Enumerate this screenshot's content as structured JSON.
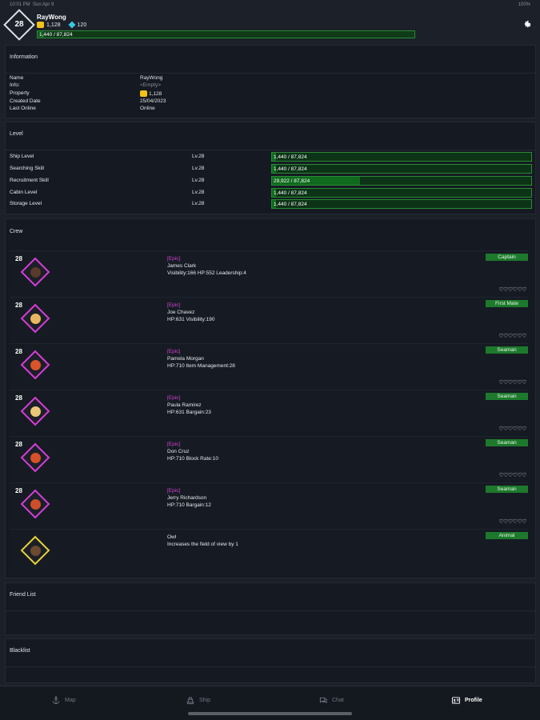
{
  "statusbar": {
    "time": "10:01 PM",
    "date": "Sun Apr 9",
    "battery": "100%"
  },
  "header": {
    "level": "28",
    "username": "RayWong",
    "coins": "1,128",
    "gems": "120",
    "xp_text": "1,440 / 87,824",
    "xp_fraction": 0.016
  },
  "information": {
    "title": "Information",
    "rows": [
      {
        "label": "Name",
        "value": "RayWong"
      },
      {
        "label": "Info:",
        "value": "<Empty>"
      },
      {
        "label": "Property",
        "value": "1,128",
        "icon": "coin-icon"
      },
      {
        "label": "Created Date",
        "value": "25/04/2023"
      },
      {
        "label": "Last Online",
        "value": "Online"
      }
    ]
  },
  "level": {
    "title": "Level",
    "rows": [
      {
        "label": "Ship Level",
        "lv": "Lv.28",
        "bar": "1,440 / 87,824",
        "fraction": 0.016
      },
      {
        "label": "Searching Skill",
        "lv": "Lv.28",
        "bar": "1,440 / 87,824",
        "fraction": 0.016
      },
      {
        "label": "Recruitment Skill",
        "lv": "Lv.28",
        "bar": "29,922 / 87,824",
        "fraction": 0.34
      },
      {
        "label": "Cabin Level",
        "lv": "Lv.28",
        "bar": "1,440 / 87,824",
        "fraction": 0.016
      },
      {
        "label": "Storage Level",
        "lv": "Lv.28",
        "bar": "1,440 / 87,824",
        "fraction": 0.016
      }
    ]
  },
  "crew": {
    "title": "Crew",
    "members": [
      {
        "level": "28",
        "tier": "[Epic]",
        "name": "James Clark",
        "stats": "Visibility:166  HP:552  Leadership:4",
        "role": "Captain",
        "hearts": "♡♡♡♡♡♡",
        "face": "#5a3a2a"
      },
      {
        "level": "28",
        "tier": "[Epic]",
        "name": "Joe Chavez",
        "stats": "HP:631  Visibility:190",
        "role": "First Mate",
        "hearts": "♡♡♡♡♡♡",
        "face": "#e8b860"
      },
      {
        "level": "28",
        "tier": "[Epic]",
        "name": "Pamela Morgan",
        "stats": "HP:710  Item Management:28",
        "role": "Seaman",
        "hearts": "♡♡♡♡♡♡",
        "face": "#d8542a"
      },
      {
        "level": "28",
        "tier": "[Epic]",
        "name": "Paula Ramirez",
        "stats": "HP:631  Bargain:23",
        "role": "Seaman",
        "hearts": "♡♡♡♡♡♡",
        "face": "#eac878"
      },
      {
        "level": "28",
        "tier": "[Epic]",
        "name": "Don Cruz",
        "stats": "HP:710  Block Rate:10",
        "role": "Seaman",
        "hearts": "♡♡♡♡♡♡",
        "face": "#d6502a"
      },
      {
        "level": "28",
        "tier": "[Epic]",
        "name": "Jerry Richardson",
        "stats": "HP:710  Bargain:12",
        "role": "Seaman",
        "hearts": "♡♡♡♡♡♡",
        "face": "#cf4e2a"
      },
      {
        "level": "",
        "tier": "",
        "name": "Owl",
        "stats": "Increases the field of view by 1",
        "role": "Animal",
        "hearts": "",
        "face": "#6b4a2e"
      }
    ]
  },
  "friends": {
    "title": "Friend List"
  },
  "blacklist": {
    "title": "Blacklist"
  },
  "nav": {
    "items": [
      {
        "label": "Map",
        "icon": "anchor-icon"
      },
      {
        "label": "Ship",
        "icon": "ship-icon"
      },
      {
        "label": "Chat",
        "icon": "chat-icon"
      },
      {
        "label": "Profile",
        "icon": "profile-icon",
        "active": true
      }
    ]
  }
}
